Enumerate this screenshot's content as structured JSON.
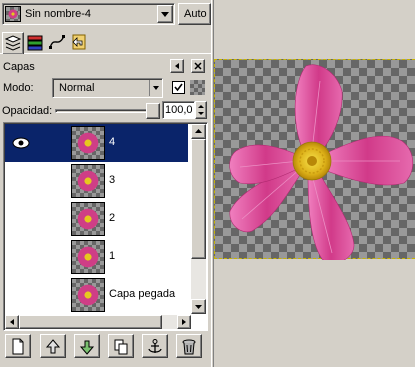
{
  "image_selector": {
    "title": "Sin nombre-4",
    "auto_label": "Auto"
  },
  "dock_tabs": [
    {
      "icon": "layers-icon"
    },
    {
      "icon": "channels-icon"
    },
    {
      "icon": "paths-icon"
    },
    {
      "icon": "undo-history-icon"
    }
  ],
  "layers_panel": {
    "title": "Capas",
    "mode_label": "Modo:",
    "mode_value": "Normal",
    "opacity_label": "Opacidad:",
    "opacity_value": "100,0",
    "opacity_fraction": 1.0,
    "layers": [
      {
        "name": "4",
        "selected": true,
        "visible": true
      },
      {
        "name": "3",
        "selected": false,
        "visible": false
      },
      {
        "name": "2",
        "selected": false,
        "visible": false
      },
      {
        "name": "1",
        "selected": false,
        "visible": false
      },
      {
        "name": "Capa pegada",
        "selected": false,
        "visible": false
      }
    ]
  },
  "bottom_buttons": [
    {
      "icon": "new-layer-icon"
    },
    {
      "icon": "raise-layer-icon"
    },
    {
      "icon": "lower-layer-icon"
    },
    {
      "icon": "duplicate-layer-icon"
    },
    {
      "icon": "anchor-layer-icon"
    },
    {
      "icon": "delete-layer-icon"
    }
  ],
  "colors": {
    "selection": "#0a246a",
    "face": "#d4d0c8",
    "petal": "#d2408c",
    "center": "#e8c21a"
  }
}
